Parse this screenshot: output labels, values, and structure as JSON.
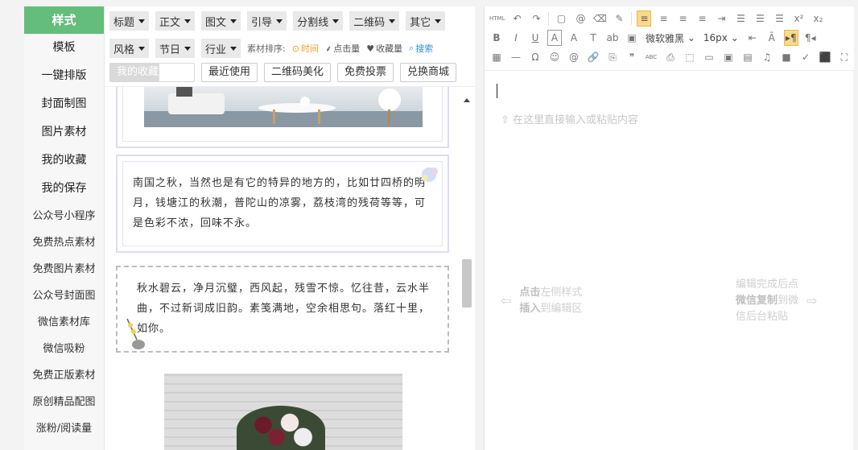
{
  "leftnav": {
    "items": [
      {
        "label": "样式",
        "active": true
      },
      {
        "label": "模板"
      },
      {
        "label": "一键排版"
      },
      {
        "label": "封面制图"
      },
      {
        "label": "图片素材"
      },
      {
        "label": "我的收藏"
      },
      {
        "label": "我的保存"
      },
      {
        "label": "公众号小程序"
      },
      {
        "label": "免费热点素材"
      },
      {
        "label": "免费图片素材"
      },
      {
        "label": "公众号封面图"
      },
      {
        "label": "微信素材库"
      },
      {
        "label": "微信吸粉"
      },
      {
        "label": "免费正版素材"
      },
      {
        "label": "原创精品配图"
      },
      {
        "label": "涨粉/阅读量"
      }
    ]
  },
  "filters": {
    "row1": [
      "标题",
      "正文",
      "图文",
      "引导",
      "分割线",
      "二维码",
      "其它"
    ],
    "row2": [
      "风格",
      "节日",
      "行业"
    ],
    "sort_label": "素材排序:",
    "sort_time": "时间",
    "sort_clicks": "点击量",
    "sort_favs": "收藏量",
    "search": "搜索",
    "row3": {
      "my_favs": "我的收藏",
      "recent": "最近使用",
      "qr_beautify": "二维码美化",
      "free_vote": "免费投票",
      "exchange_mall": "兑换商城"
    }
  },
  "cards": {
    "card2_text": "南国之秋，当然也是有它的特异的地方的，比如廿四桥的明月，钱塘江的秋潮，普陀山的凉雾，荔枝湾的残荷等等，可是色彩不浓，回味不永。",
    "card3_text": "秋水碧云，净月沉璧，西风起，残雪不惊。忆往昔，云水半曲，不过新词成旧韵。素笺满地，空余相思句。落红十里，如你。"
  },
  "editor": {
    "toolbar_row1": [
      "HTML",
      "↶",
      "↷",
      "▢",
      "@",
      "⌫",
      "✎",
      "≡",
      "≡",
      "≡",
      "≡",
      "⇥",
      "☰",
      "☰",
      "☰",
      "x²",
      "x₂"
    ],
    "toolbar_row2_font": "微软雅黑",
    "toolbar_row2_size": "16px",
    "toolbar_row2": [
      "B",
      "I",
      "U",
      "A",
      "A",
      "T",
      "ab",
      "▣"
    ],
    "toolbar_row3": [
      "▦",
      "—",
      "Ω",
      "☺",
      "@",
      "🔗",
      "⎘",
      "❞",
      "ABC",
      "⎙",
      "⬚",
      "▭",
      "▣",
      "▤",
      "♫",
      "■",
      "✓",
      "⬛",
      "⛶"
    ],
    "placeholder": "在这里直接输入或粘贴内容",
    "hint_left_pre": "点击",
    "hint_left_mid": "左侧样式",
    "hint_left_line2_pre": "插入",
    "hint_left_line2_post": "到编辑区",
    "hint_right_line1": "编辑完成后点",
    "hint_right_bold": "微信复制",
    "hint_right_mid": "到微",
    "hint_right_line3": "信后台粘贴"
  },
  "colors": {
    "nav_active": "#64bd7a",
    "sort_time": "#f0a020",
    "search": "#2f8fe0",
    "toolbar_active": "#fbd98a"
  }
}
